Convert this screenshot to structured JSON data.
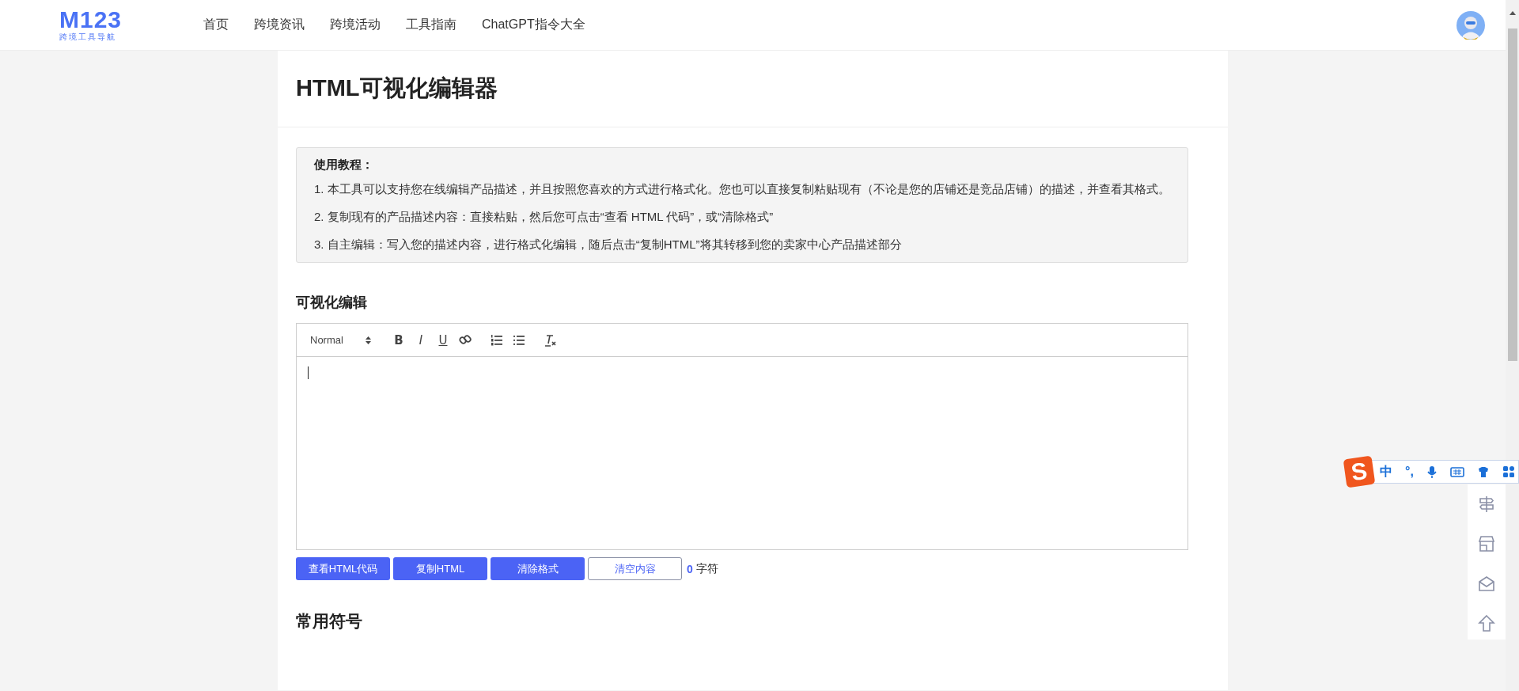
{
  "header": {
    "logo": {
      "mark": "M123",
      "tagline": "跨境工具导航"
    },
    "nav": [
      {
        "label": "首页"
      },
      {
        "label": "跨境资讯"
      },
      {
        "label": "跨境活动"
      },
      {
        "label": "工具指南"
      },
      {
        "label": "ChatGPT指令大全"
      }
    ]
  },
  "page": {
    "title": "HTML可视化编辑器"
  },
  "tutorial": {
    "heading": "使用教程：",
    "steps": [
      "1. 本工具可以支持您在线编辑产品描述，并且按照您喜欢的方式进行格式化。您也可以直接复制粘贴现有（不论是您的店铺还是竞品店铺）的描述，并查看其格式。",
      "2. 复制现有的产品描述内容：直接粘贴，然后您可点击“查看 HTML 代码”，或“清除格式”",
      "3. 自主编辑：写入您的描述内容，进行格式化编辑，随后点击“复制HTML”将其转移到您的卖家中心产品描述部分"
    ]
  },
  "editor": {
    "heading": "可视化编辑",
    "format": "Normal",
    "tools": [
      {
        "kind": "bold",
        "label": "B"
      },
      {
        "kind": "italic",
        "label": "I"
      },
      {
        "kind": "underline",
        "label": "U"
      },
      {
        "kind": "link"
      },
      {
        "kind": "ordered"
      },
      {
        "kind": "bullet"
      },
      {
        "kind": "clean"
      }
    ]
  },
  "actions": [
    {
      "label": "查看HTML代码",
      "kind": "primary"
    },
    {
      "label": "复制HTML",
      "kind": "primary"
    },
    {
      "label": "清除格式",
      "kind": "primary"
    },
    {
      "label": "清空内容",
      "kind": "outline"
    }
  ],
  "char_count": {
    "value": "0",
    "unit": "字符"
  },
  "symbols": {
    "heading": "常用符号"
  },
  "ime": {
    "logo": "S",
    "items": [
      {
        "kind": "text",
        "label": "中"
      },
      {
        "kind": "text",
        "label": "°,"
      },
      {
        "kind": "mic"
      },
      {
        "kind": "keyboard"
      },
      {
        "kind": "skin"
      },
      {
        "kind": "apps"
      }
    ]
  },
  "side_tools": [
    {
      "kind": "signpost"
    },
    {
      "kind": "shop"
    },
    {
      "kind": "mail"
    },
    {
      "kind": "top"
    }
  ]
}
